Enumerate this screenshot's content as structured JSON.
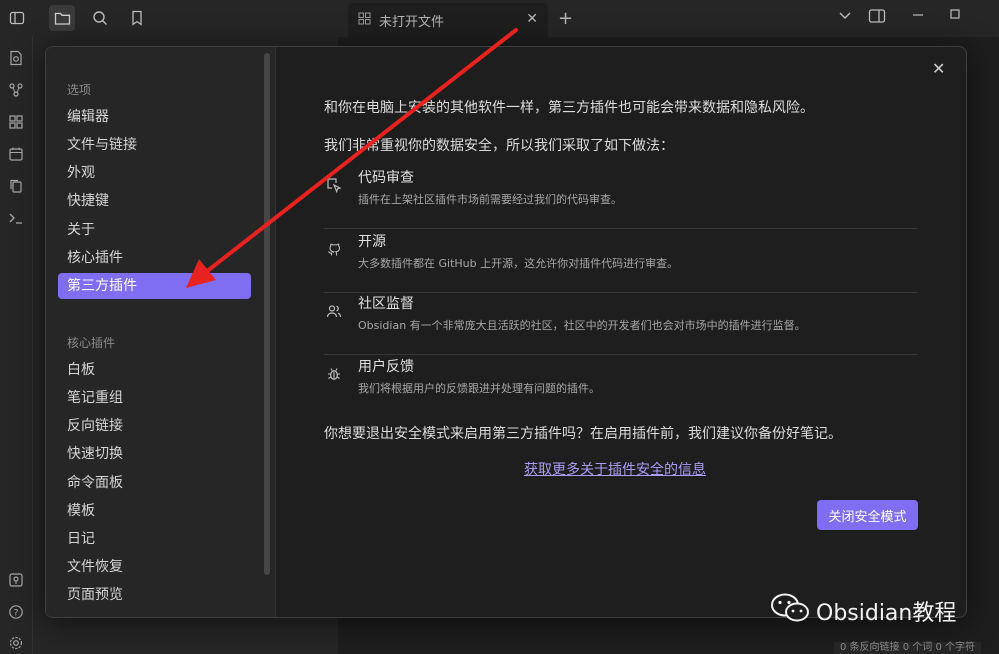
{
  "tab": {
    "title": "未打开文件"
  },
  "settings": {
    "section_options_heading": "选项",
    "options": [
      "编辑器",
      "文件与链接",
      "外观",
      "快捷键",
      "关于",
      "核心插件",
      "第三方插件"
    ],
    "section_core_heading": "核心插件",
    "core_plugins": [
      "白板",
      "笔记重组",
      "反向链接",
      "快速切换",
      "命令面板",
      "模板",
      "日记",
      "文件恢复",
      "页面预览"
    ]
  },
  "content": {
    "intro": "和你在电脑上安装的其他软件一样，第三方插件也可能会带来数据和隐私风险。",
    "measures_intro": "我们非常重视你的数据安全，所以我们采取了如下做法：",
    "features": [
      {
        "icon": "code-review-icon",
        "title": "代码审查",
        "desc": "插件在上架社区插件市场前需要经过我们的代码审查。"
      },
      {
        "icon": "github-icon",
        "title": "开源",
        "desc": "大多数插件都在 GitHub 上开源，这允许你对插件代码进行审查。"
      },
      {
        "icon": "users-icon",
        "title": "社区监督",
        "desc": "Obsidian 有一个非常庞大且活跃的社区，社区中的开发者们也会对市场中的插件进行监督。"
      },
      {
        "icon": "bug-icon",
        "title": "用户反馈",
        "desc": "我们将根据用户的反馈跟进并处理有问题的插件。"
      }
    ],
    "question": "你想要退出安全模式来启用第三方插件吗？在启用插件前，我们建议你备份好笔记。",
    "link": "获取更多关于插件安全的信息",
    "button": "关闭安全模式"
  },
  "watermark": {
    "text": "Obsidian教程"
  },
  "status_bar": {
    "text": "0 条反向链接   0 个词   0 个字符"
  },
  "colors": {
    "accent": "#7f6df2",
    "arrow": "#e8231f"
  }
}
